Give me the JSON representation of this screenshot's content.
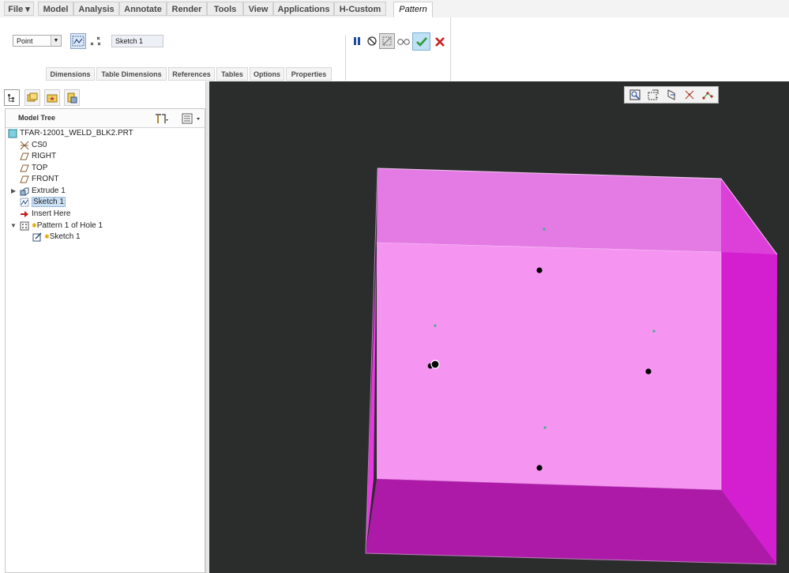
{
  "ribbon": {
    "tabs": [
      "File ▾",
      "Model",
      "Analysis",
      "Annotate",
      "Render",
      "Tools",
      "View",
      "Applications",
      "H-Custom",
      "Pattern"
    ],
    "active_tab": "Pattern"
  },
  "dashboard": {
    "pattern_type": "Point",
    "sketch_name": "Sketch 1",
    "subtabs": [
      "Dimensions",
      "Table Dimensions",
      "References",
      "Tables",
      "Options",
      "Properties"
    ],
    "icons": [
      "sketch-icon",
      "points-icon",
      "pause-icon",
      "no-preview-icon",
      "verify-icon",
      "glasses-icon",
      "ok-checkmark-icon",
      "cancel-x-icon"
    ],
    "colors": {
      "ok": "#2e9b3a",
      "cancel": "#c8201f",
      "pause": "#1e4aa0"
    }
  },
  "model_tree": {
    "title": "Model Tree",
    "items": [
      {
        "label": "TFAR-12001_WELD_BLK2.PRT",
        "icon": "part-icon"
      },
      {
        "label": "CS0",
        "icon": "csys-icon"
      },
      {
        "label": "RIGHT",
        "icon": "datum-plane-icon"
      },
      {
        "label": "TOP",
        "icon": "datum-plane-icon"
      },
      {
        "label": "FRONT",
        "icon": "datum-plane-icon"
      },
      {
        "label": "Extrude 1",
        "icon": "extrude-icon"
      },
      {
        "label": "Sketch 1",
        "icon": "sketch-icon"
      },
      {
        "label": "Insert Here",
        "icon": "insert-arrow-icon"
      },
      {
        "label": "Pattern 1 of Hole 1",
        "icon": "pattern-icon"
      },
      {
        "label": "Sketch 1",
        "icon": "sketch-edit-icon"
      }
    ]
  },
  "viewport": {
    "background": "#2b2d2d",
    "part_color": "#f48ff0",
    "toolbar_icons": [
      "refit-icon",
      "annotation-display-icon",
      "plane-display-icon",
      "csys-display-icon",
      "point-display-icon"
    ]
  }
}
